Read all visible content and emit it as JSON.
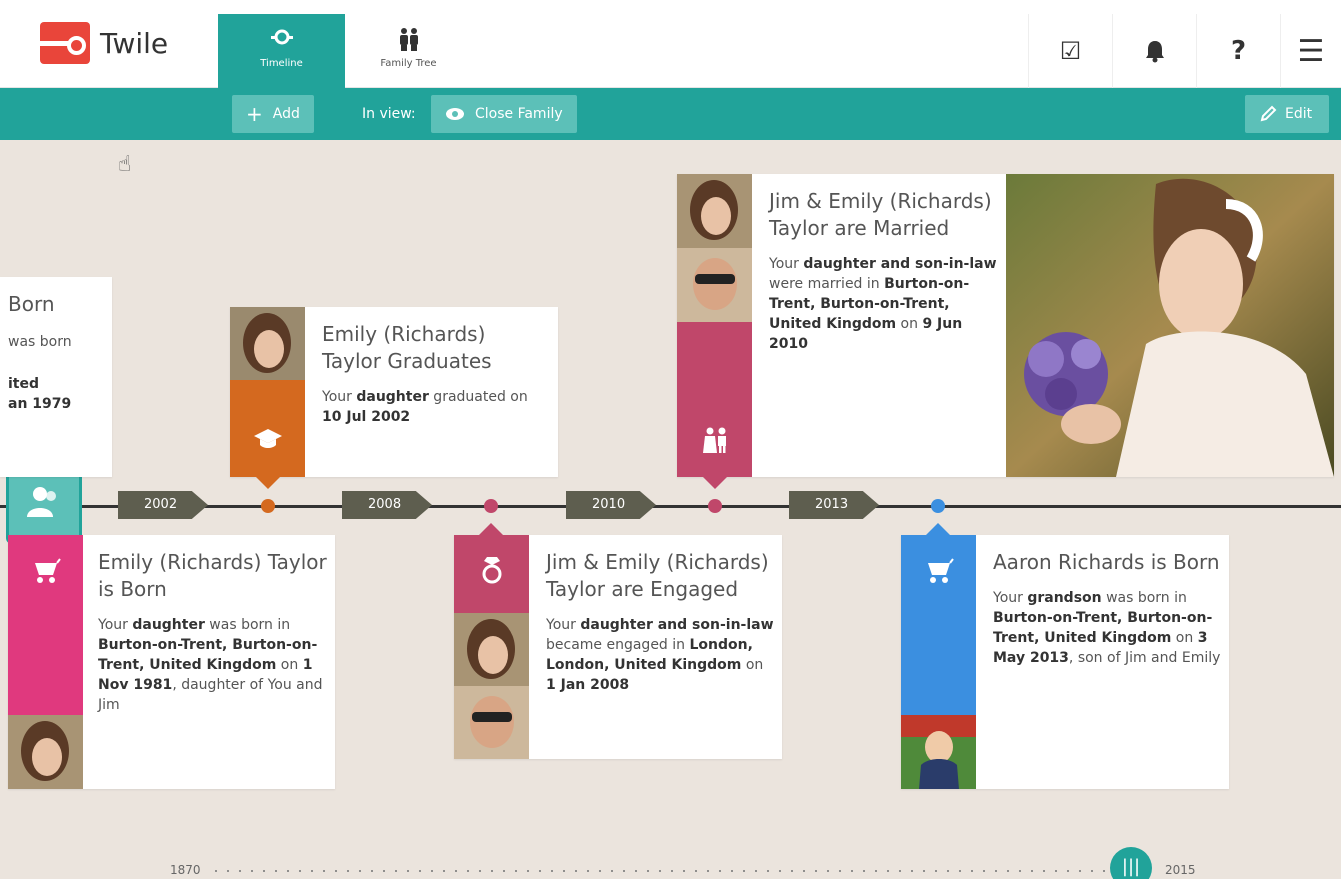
{
  "app": {
    "name": "Twile"
  },
  "nav": {
    "tabs": [
      {
        "label": "Timeline",
        "icon": "timeline-icon",
        "active": true
      },
      {
        "label": "Family Tree",
        "icon": "family-tree-icon",
        "active": false
      }
    ],
    "header_buttons": [
      {
        "icon": "checkbox-icon",
        "glyph": "☑"
      },
      {
        "icon": "bell-icon",
        "glyph": "🔔"
      },
      {
        "icon": "help-icon",
        "glyph": "?"
      },
      {
        "icon": "menu-icon",
        "glyph": "☰"
      }
    ]
  },
  "toolbar": {
    "add_label": "Add",
    "in_view_label": "In view:",
    "view_value": "Close Family",
    "edit_label": "Edit"
  },
  "timeline": {
    "years": [
      "2002",
      "2008",
      "2010",
      "2013"
    ],
    "range_start": "1870",
    "range_end": "2015"
  },
  "events": {
    "partial_birth": {
      "title": "Born",
      "line1": "was born",
      "line2": "ited",
      "line3": "an 1979"
    },
    "graduation": {
      "title": "Emily (Richards) Taylor Graduates",
      "body_pre": "Your ",
      "body_bold1": "daughter",
      "body_mid": " graduated on ",
      "body_bold2": "10 Jul 2002",
      "color": "#d4691f"
    },
    "married": {
      "title": "Jim & Emily (Richards) Taylor are Married",
      "body_pre": "Your ",
      "body_bold1": "daughter and son-in-law",
      "body_mid": " were married in ",
      "body_bold2": "Burton-on-Trent, Burton-on-Trent, United Kingdom",
      "body_mid2": " on ",
      "body_bold3": "9 Jun 2010",
      "color": "#c0476a"
    },
    "born_emily": {
      "title": "Emily (Richards) Taylor is Born",
      "body_pre": "Your ",
      "body_bold1": "daughter",
      "body_mid": " was born in ",
      "body_bold2": "Burton-on-Trent, Burton-on-Trent, United Kingdom",
      "body_mid2": " on ",
      "body_bold3": "1 Nov 1981",
      "body_end": ", daughter of You and Jim",
      "color": "#e0397e"
    },
    "engaged": {
      "title": "Jim & Emily (Richards) Taylor are Engaged",
      "body_pre": "Your ",
      "body_bold1": "daughter and son-in-law",
      "body_mid": " became engaged in ",
      "body_bold2": "London, London, United Kingdom",
      "body_mid2": " on ",
      "body_bold3": "1 Jan 2008",
      "color": "#c0476a"
    },
    "born_aaron": {
      "title": "Aaron Richards is Born",
      "body_pre": "Your ",
      "body_bold1": "grandson",
      "body_mid": " was born in ",
      "body_bold2": "Burton-on-Trent, Burton-on-Trent, United Kingdom",
      "body_mid2": " on ",
      "body_bold3": "3 May 2013",
      "body_end": ", son of Jim and Emily",
      "color": "#3b8fe0"
    }
  },
  "colors": {
    "teal": "#21a39a",
    "teal_light": "#5cc0b8",
    "background": "#ebe4dd"
  }
}
